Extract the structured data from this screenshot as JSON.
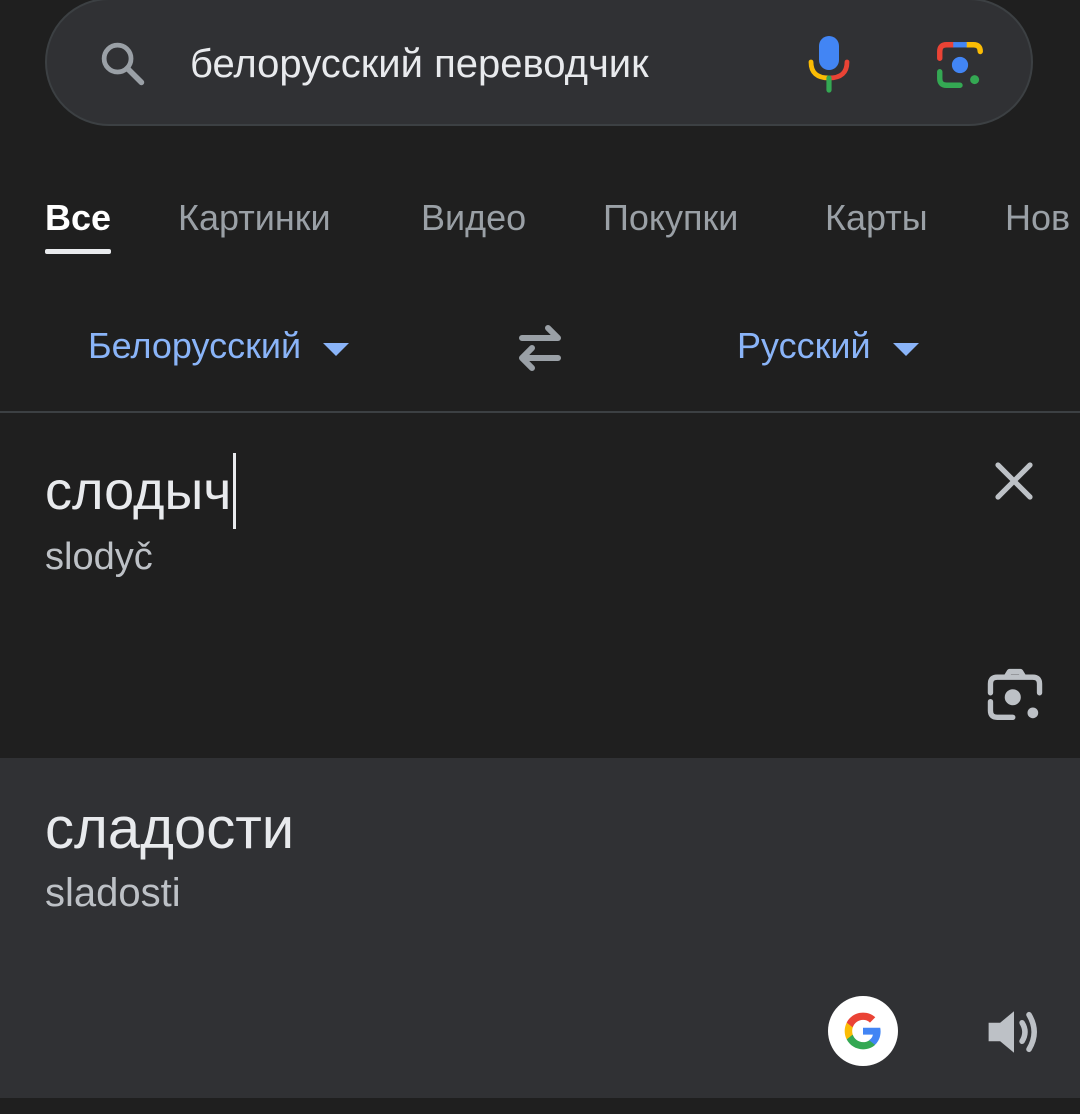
{
  "search": {
    "query": "белорусский переводчик",
    "icons": [
      "search-icon",
      "mic-icon",
      "lens-icon"
    ]
  },
  "tabs": [
    {
      "label": "Все",
      "active": true
    },
    {
      "label": "Картинки",
      "active": false
    },
    {
      "label": "Видео",
      "active": false
    },
    {
      "label": "Покупки",
      "active": false
    },
    {
      "label": "Карты",
      "active": false
    },
    {
      "label": "Нов",
      "active": false
    }
  ],
  "translator": {
    "source_language": "Белорусский",
    "target_language": "Русский",
    "source_text": "слодыч",
    "source_transliteration": "slodyč",
    "result_text": "сладости",
    "result_transliteration": "sladosti"
  },
  "colors": {
    "background": "#1f1f1f",
    "result_background": "#303134",
    "accent": "#8ab4f8",
    "text": "#e8eaed",
    "muted_text": "#9aa0a6"
  }
}
